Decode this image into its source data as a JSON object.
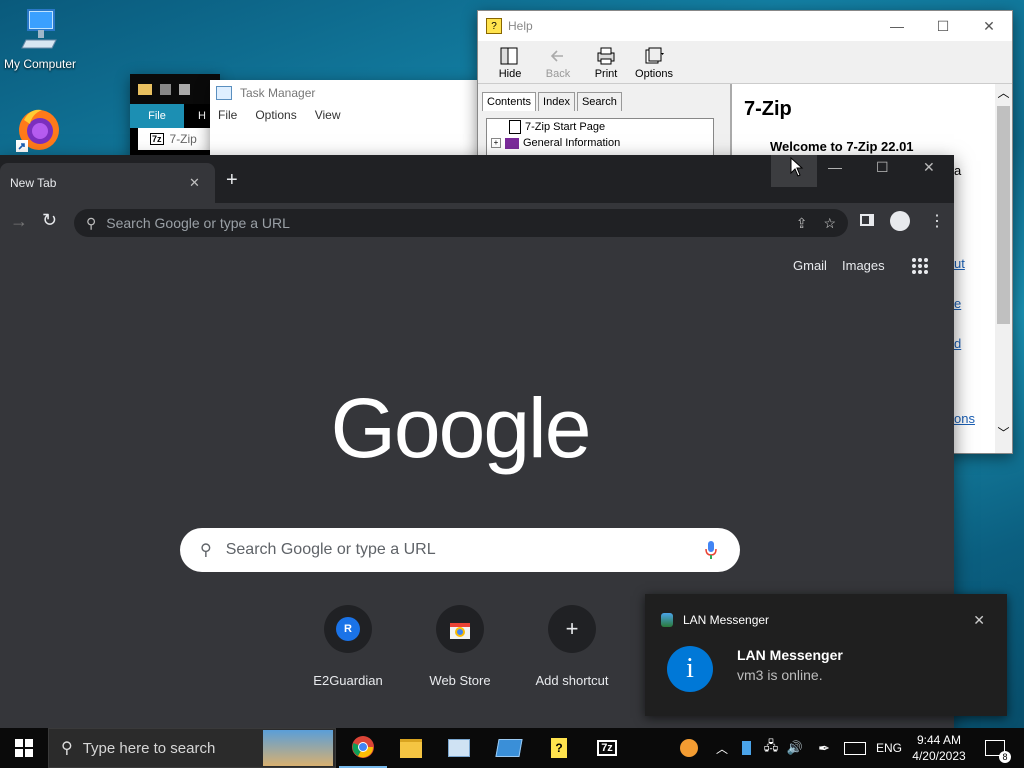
{
  "desktop": {
    "icons": [
      {
        "label": "My Computer"
      }
    ]
  },
  "help_window": {
    "title": "Help",
    "toolbar": [
      {
        "label": "Hide",
        "enabled": true
      },
      {
        "label": "Back",
        "enabled": false
      },
      {
        "label": "Print",
        "enabled": true
      },
      {
        "label": "Options",
        "enabled": true
      }
    ],
    "tabs": [
      "Contents",
      "Index",
      "Search"
    ],
    "active_tab": "Contents",
    "tree": [
      {
        "label": "7-Zip Start Page"
      },
      {
        "label": "General Information"
      }
    ],
    "content": {
      "heading": "7-Zip",
      "welcome": "Welcome to 7-Zip 22.01",
      "partial_links": [
        "a",
        "ut",
        "e",
        "d",
        "ons"
      ]
    }
  },
  "task_manager": {
    "title": "Task Manager",
    "menu": [
      "File",
      "Options",
      "View"
    ]
  },
  "zip_window": {
    "file_label": "File",
    "h_label": "H",
    "title": "7-Zip"
  },
  "chrome": {
    "tab_title": "New Tab",
    "omnibox_placeholder": "Search Google or type a URL",
    "top_links": [
      "Gmail",
      "Images"
    ],
    "logo_text": "Google",
    "search_placeholder": "Search Google or type a URL",
    "shortcuts": [
      {
        "label": "E2Guardian",
        "letter": "R"
      },
      {
        "label": "Web Store"
      },
      {
        "label": "Add shortcut"
      }
    ]
  },
  "toast": {
    "app": "LAN Messenger",
    "title": "LAN Messenger",
    "message": "vm3 is online."
  },
  "taskbar": {
    "search_placeholder": "Type here to search",
    "lang": "ENG",
    "time": "9:44 AM",
    "date": "4/20/2023",
    "notification_count": "8"
  },
  "colors": {
    "chrome_bg": "#35363a",
    "chrome_tabbar": "#202124",
    "toast_bg": "#1f1f1f",
    "info_blue": "#0078d7"
  }
}
